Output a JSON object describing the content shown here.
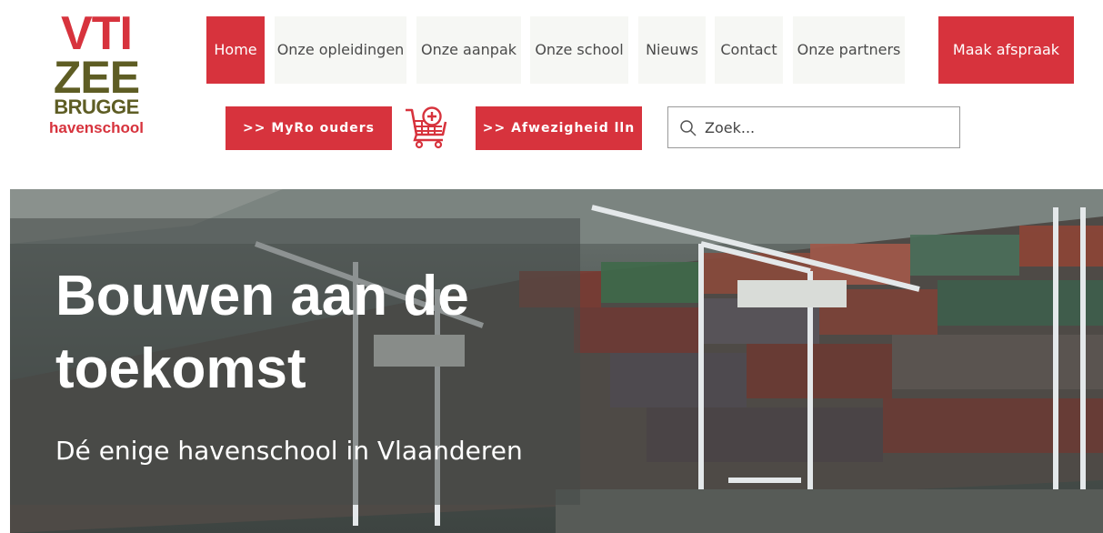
{
  "logo": {
    "line1": "VTI",
    "line2": "ZEE",
    "line3": "BRUGGE",
    "line4": "havenschool"
  },
  "nav": {
    "items": [
      {
        "label": "Home",
        "active": true
      },
      {
        "label": "Onze opleidingen",
        "active": false
      },
      {
        "label": "Onze aanpak",
        "active": false
      },
      {
        "label": "Onze school",
        "active": false
      },
      {
        "label": "Nieuws",
        "active": false
      },
      {
        "label": "Contact",
        "active": false
      },
      {
        "label": "Onze partners",
        "active": false
      }
    ],
    "cta_label": "Maak afspraak"
  },
  "actions": {
    "myro_label": ">> MyRo ouders",
    "afwezigheid_label": ">> Afwezigheid lln",
    "cart_icon": "shopping-cart-plus-icon"
  },
  "search": {
    "placeholder": "Zoek...",
    "value": ""
  },
  "hero": {
    "title": "Bouwen aan de toekomst",
    "subtitle": "Dé enige havenschool in Vlaanderen"
  },
  "colors": {
    "brand_red": "#d7333d",
    "brand_olive": "#5e5d24",
    "nav_bg": "#f6f7f4"
  }
}
